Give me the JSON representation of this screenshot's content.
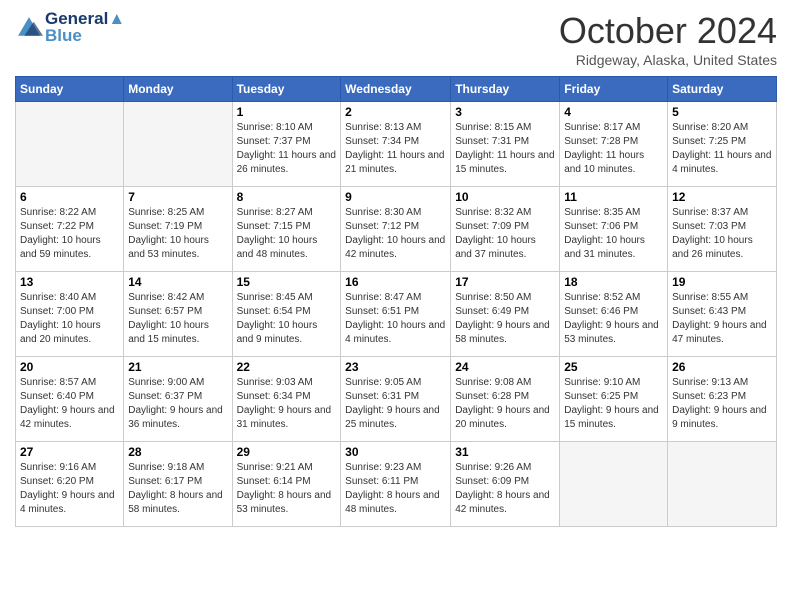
{
  "header": {
    "logo_line1": "General",
    "logo_line2": "Blue",
    "month_title": "October 2024",
    "location": "Ridgeway, Alaska, United States"
  },
  "weekdays": [
    "Sunday",
    "Monday",
    "Tuesday",
    "Wednesday",
    "Thursday",
    "Friday",
    "Saturday"
  ],
  "weeks": [
    [
      {
        "day": "",
        "info": ""
      },
      {
        "day": "",
        "info": ""
      },
      {
        "day": "1",
        "info": "Sunrise: 8:10 AM\nSunset: 7:37 PM\nDaylight: 11 hours and 26 minutes."
      },
      {
        "day": "2",
        "info": "Sunrise: 8:13 AM\nSunset: 7:34 PM\nDaylight: 11 hours and 21 minutes."
      },
      {
        "day": "3",
        "info": "Sunrise: 8:15 AM\nSunset: 7:31 PM\nDaylight: 11 hours and 15 minutes."
      },
      {
        "day": "4",
        "info": "Sunrise: 8:17 AM\nSunset: 7:28 PM\nDaylight: 11 hours and 10 minutes."
      },
      {
        "day": "5",
        "info": "Sunrise: 8:20 AM\nSunset: 7:25 PM\nDaylight: 11 hours and 4 minutes."
      }
    ],
    [
      {
        "day": "6",
        "info": "Sunrise: 8:22 AM\nSunset: 7:22 PM\nDaylight: 10 hours and 59 minutes."
      },
      {
        "day": "7",
        "info": "Sunrise: 8:25 AM\nSunset: 7:19 PM\nDaylight: 10 hours and 53 minutes."
      },
      {
        "day": "8",
        "info": "Sunrise: 8:27 AM\nSunset: 7:15 PM\nDaylight: 10 hours and 48 minutes."
      },
      {
        "day": "9",
        "info": "Sunrise: 8:30 AM\nSunset: 7:12 PM\nDaylight: 10 hours and 42 minutes."
      },
      {
        "day": "10",
        "info": "Sunrise: 8:32 AM\nSunset: 7:09 PM\nDaylight: 10 hours and 37 minutes."
      },
      {
        "day": "11",
        "info": "Sunrise: 8:35 AM\nSunset: 7:06 PM\nDaylight: 10 hours and 31 minutes."
      },
      {
        "day": "12",
        "info": "Sunrise: 8:37 AM\nSunset: 7:03 PM\nDaylight: 10 hours and 26 minutes."
      }
    ],
    [
      {
        "day": "13",
        "info": "Sunrise: 8:40 AM\nSunset: 7:00 PM\nDaylight: 10 hours and 20 minutes."
      },
      {
        "day": "14",
        "info": "Sunrise: 8:42 AM\nSunset: 6:57 PM\nDaylight: 10 hours and 15 minutes."
      },
      {
        "day": "15",
        "info": "Sunrise: 8:45 AM\nSunset: 6:54 PM\nDaylight: 10 hours and 9 minutes."
      },
      {
        "day": "16",
        "info": "Sunrise: 8:47 AM\nSunset: 6:51 PM\nDaylight: 10 hours and 4 minutes."
      },
      {
        "day": "17",
        "info": "Sunrise: 8:50 AM\nSunset: 6:49 PM\nDaylight: 9 hours and 58 minutes."
      },
      {
        "day": "18",
        "info": "Sunrise: 8:52 AM\nSunset: 6:46 PM\nDaylight: 9 hours and 53 minutes."
      },
      {
        "day": "19",
        "info": "Sunrise: 8:55 AM\nSunset: 6:43 PM\nDaylight: 9 hours and 47 minutes."
      }
    ],
    [
      {
        "day": "20",
        "info": "Sunrise: 8:57 AM\nSunset: 6:40 PM\nDaylight: 9 hours and 42 minutes."
      },
      {
        "day": "21",
        "info": "Sunrise: 9:00 AM\nSunset: 6:37 PM\nDaylight: 9 hours and 36 minutes."
      },
      {
        "day": "22",
        "info": "Sunrise: 9:03 AM\nSunset: 6:34 PM\nDaylight: 9 hours and 31 minutes."
      },
      {
        "day": "23",
        "info": "Sunrise: 9:05 AM\nSunset: 6:31 PM\nDaylight: 9 hours and 25 minutes."
      },
      {
        "day": "24",
        "info": "Sunrise: 9:08 AM\nSunset: 6:28 PM\nDaylight: 9 hours and 20 minutes."
      },
      {
        "day": "25",
        "info": "Sunrise: 9:10 AM\nSunset: 6:25 PM\nDaylight: 9 hours and 15 minutes."
      },
      {
        "day": "26",
        "info": "Sunrise: 9:13 AM\nSunset: 6:23 PM\nDaylight: 9 hours and 9 minutes."
      }
    ],
    [
      {
        "day": "27",
        "info": "Sunrise: 9:16 AM\nSunset: 6:20 PM\nDaylight: 9 hours and 4 minutes."
      },
      {
        "day": "28",
        "info": "Sunrise: 9:18 AM\nSunset: 6:17 PM\nDaylight: 8 hours and 58 minutes."
      },
      {
        "day": "29",
        "info": "Sunrise: 9:21 AM\nSunset: 6:14 PM\nDaylight: 8 hours and 53 minutes."
      },
      {
        "day": "30",
        "info": "Sunrise: 9:23 AM\nSunset: 6:11 PM\nDaylight: 8 hours and 48 minutes."
      },
      {
        "day": "31",
        "info": "Sunrise: 9:26 AM\nSunset: 6:09 PM\nDaylight: 8 hours and 42 minutes."
      },
      {
        "day": "",
        "info": ""
      },
      {
        "day": "",
        "info": ""
      }
    ]
  ]
}
